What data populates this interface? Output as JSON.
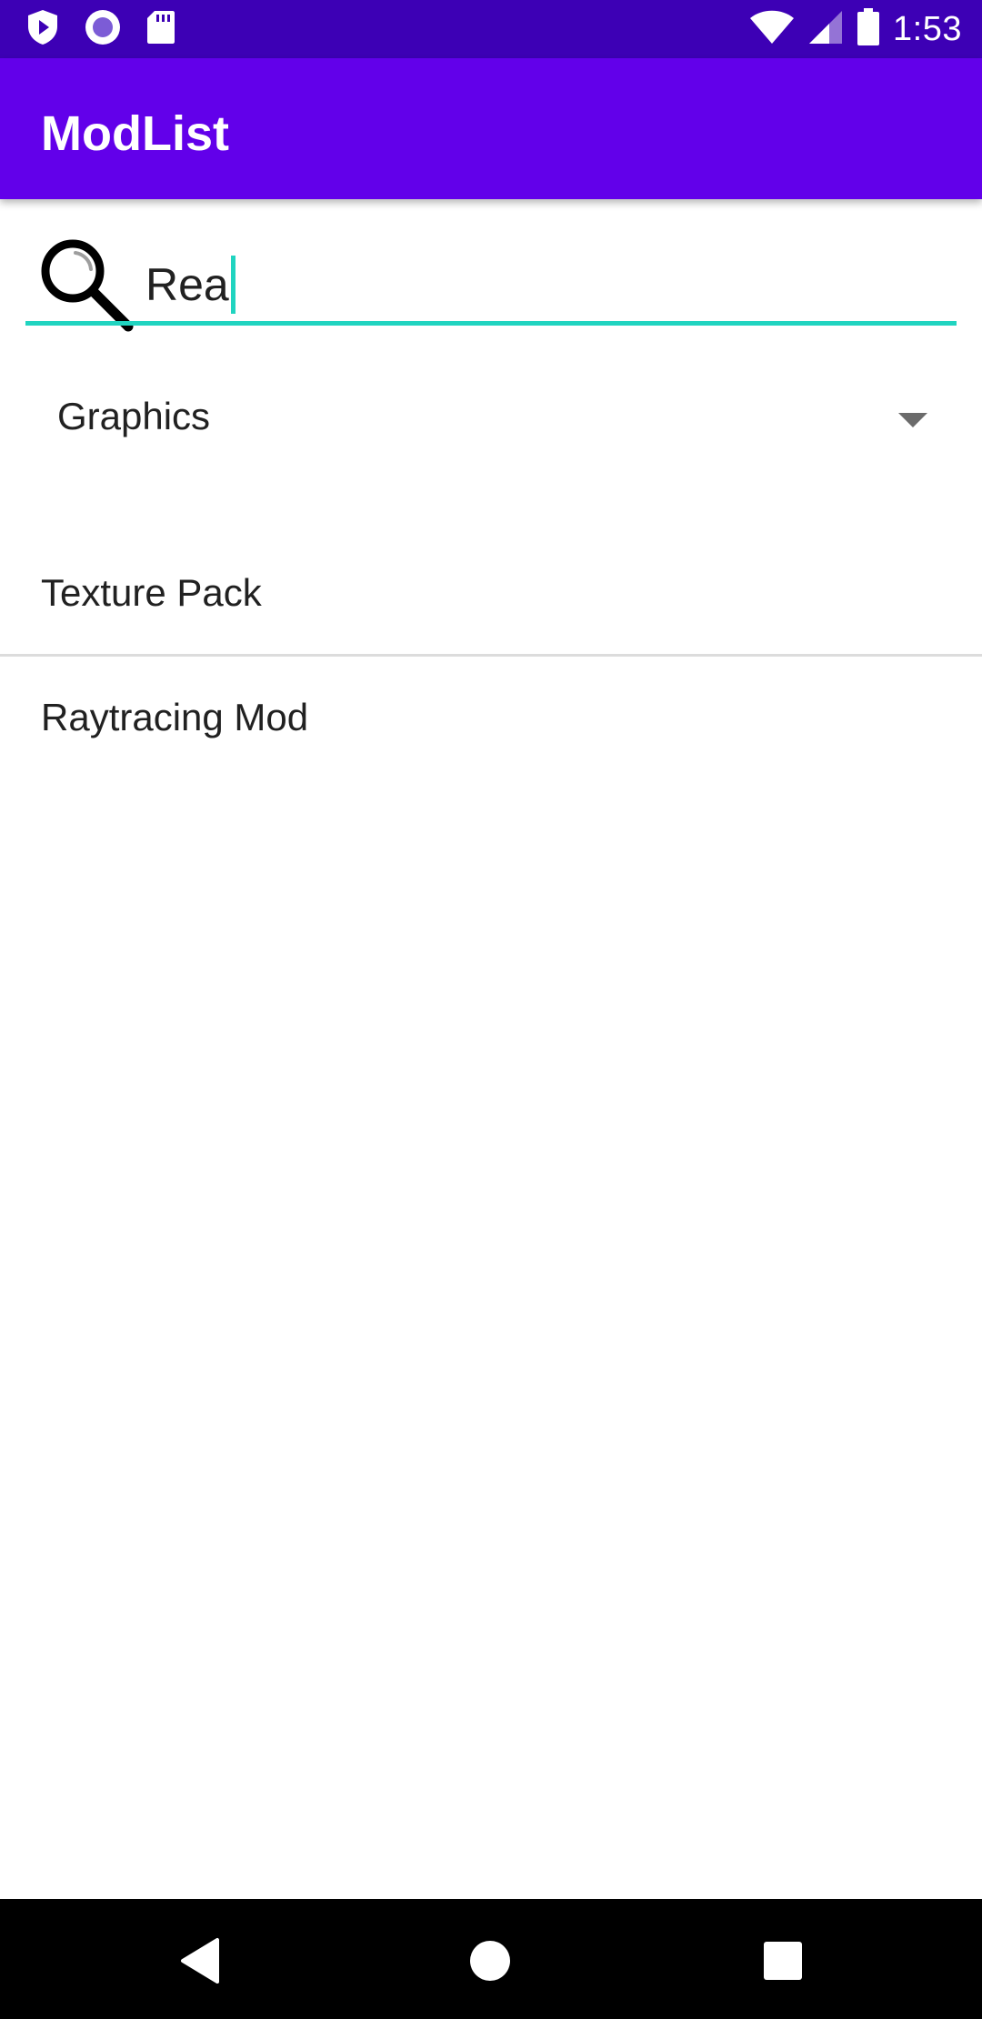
{
  "status_bar": {
    "time": "1:53",
    "icons_left": [
      "shield-play-icon",
      "record-circle-icon",
      "sd-card-icon"
    ],
    "icons_right": [
      "wifi-icon",
      "cell-signal-icon",
      "battery-icon"
    ],
    "color": "#3d00b5"
  },
  "app_bar": {
    "title": "ModList",
    "color": "#6200ea"
  },
  "search": {
    "value": "Rea",
    "icon": "search-icon",
    "accent_color": "#20d4c0"
  },
  "category_spinner": {
    "selected": "Graphics"
  },
  "mod_list": {
    "items": [
      {
        "label": "Texture Pack"
      },
      {
        "label": "Raytracing Mod"
      }
    ]
  },
  "nav_bar": {
    "buttons": [
      "back-icon",
      "home-icon",
      "recents-icon"
    ]
  }
}
